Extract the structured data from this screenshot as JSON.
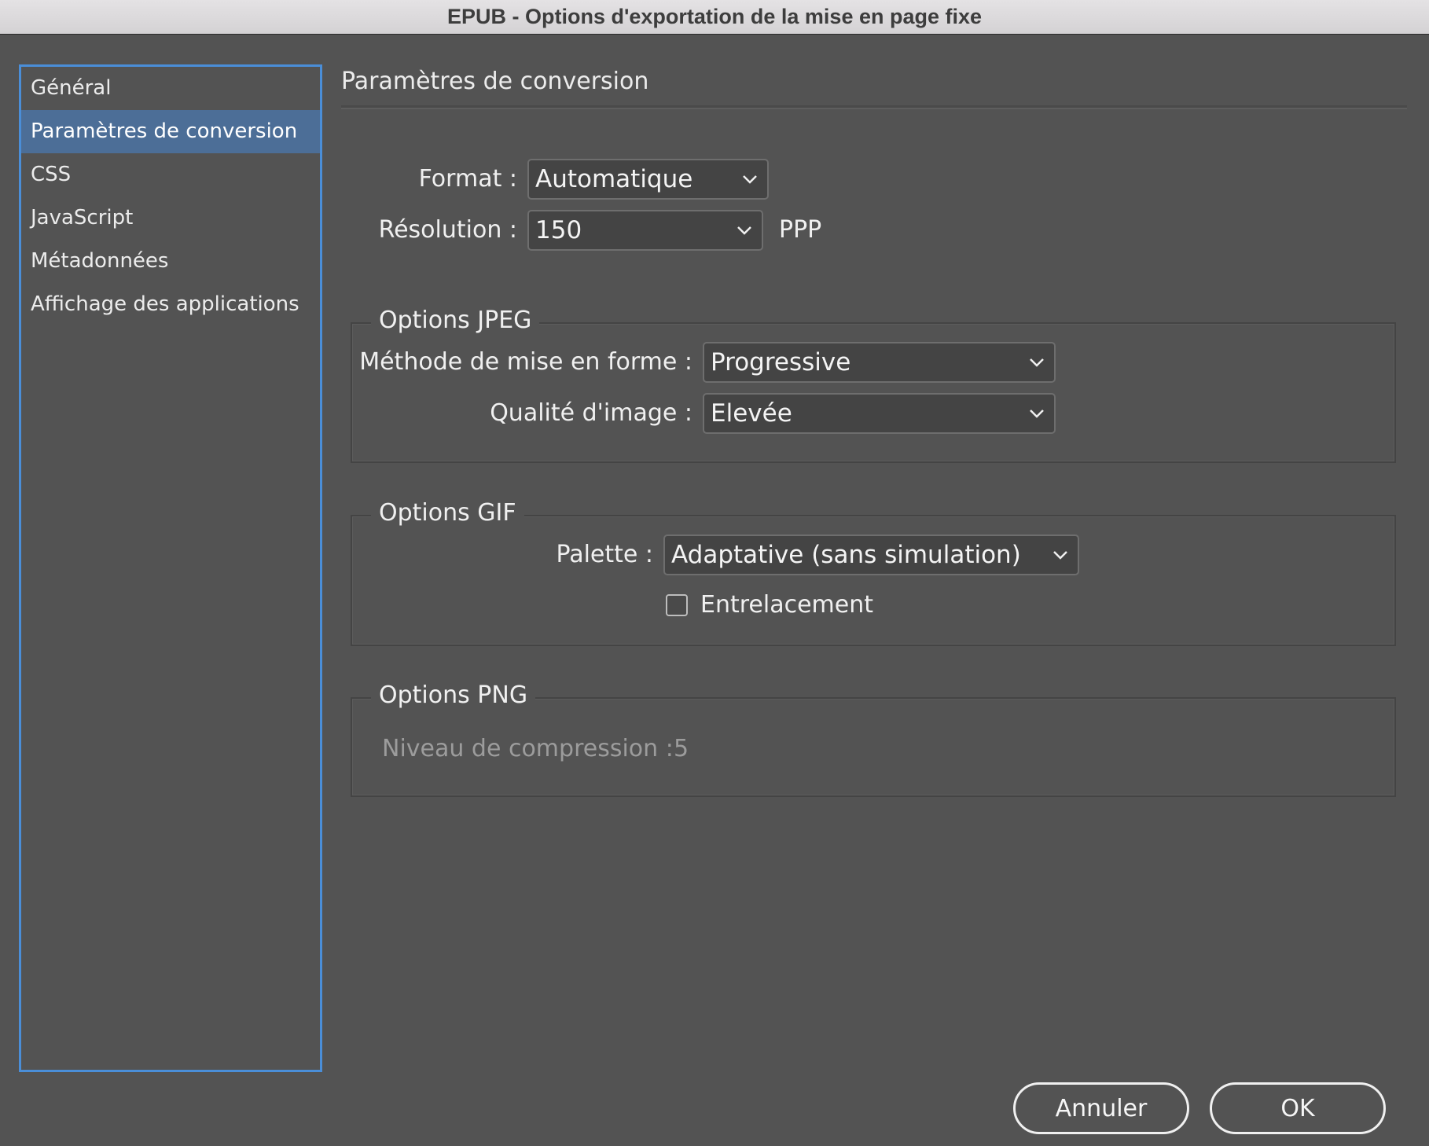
{
  "window": {
    "title": "EPUB - Options d'exportation de la mise en page fixe"
  },
  "sidebar": {
    "items": [
      {
        "label": "Général",
        "selected": false
      },
      {
        "label": "Paramètres de conversion",
        "selected": true
      },
      {
        "label": "CSS",
        "selected": false
      },
      {
        "label": "JavaScript",
        "selected": false
      },
      {
        "label": "Métadonnées",
        "selected": false
      },
      {
        "label": "Affichage des applications",
        "selected": false
      }
    ]
  },
  "main": {
    "title": "Paramètres de conversion",
    "format": {
      "label": "Format :",
      "value": "Automatique"
    },
    "resolution": {
      "label": "Résolution :",
      "value": "150",
      "unit": "PPP"
    },
    "jpeg": {
      "legend": "Options JPEG",
      "method": {
        "label": "Méthode de mise en forme :",
        "value": "Progressive"
      },
      "quality": {
        "label": "Qualité d'image :",
        "value": "Elevée"
      }
    },
    "gif": {
      "legend": "Options GIF",
      "palette": {
        "label": "Palette :",
        "value": "Adaptative (sans simulation)"
      },
      "interlace": {
        "label": "Entrelacement",
        "checked": false
      }
    },
    "png": {
      "legend": "Options PNG",
      "compression": {
        "label": "Niveau de compression :",
        "value": "5"
      }
    }
  },
  "buttons": {
    "cancel": "Annuler",
    "ok": "OK"
  },
  "colors": {
    "background": "#535353",
    "selection": "#4c6e97",
    "focus_border": "#4a8ed8"
  }
}
